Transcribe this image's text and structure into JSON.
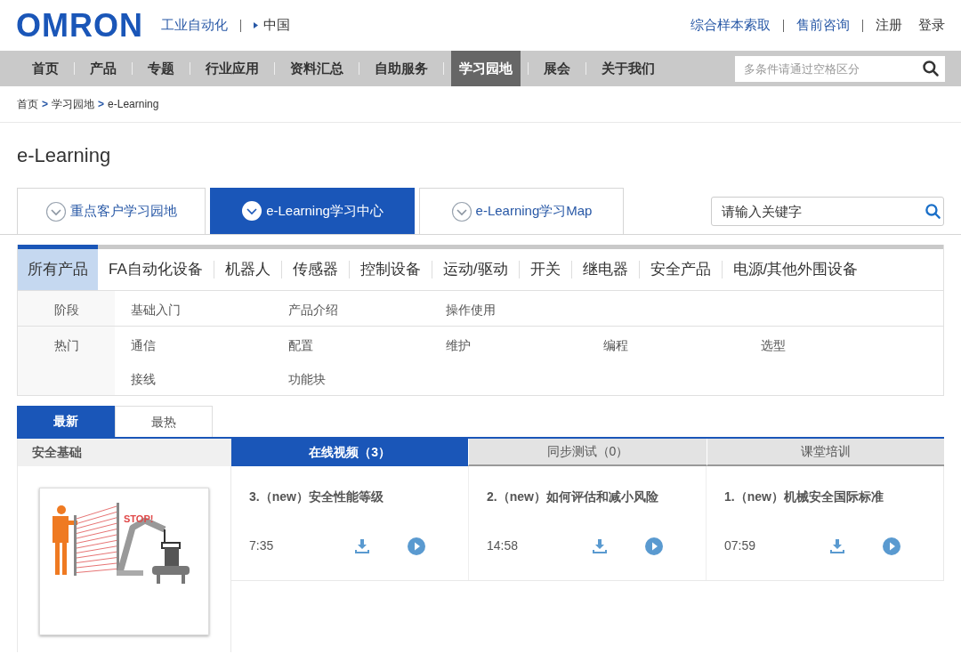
{
  "header": {
    "logo": "OMRON",
    "site": "工业自动化",
    "region": "中国",
    "links": [
      {
        "label": "综合样本索取",
        "kind": "accent"
      },
      {
        "label": "售前咨询",
        "kind": "accent"
      },
      {
        "label": "注册",
        "kind": "plain"
      },
      {
        "label": "登录",
        "kind": "plain"
      }
    ]
  },
  "nav": {
    "items": [
      {
        "label": "首页",
        "selected": false
      },
      {
        "label": "产品",
        "selected": false
      },
      {
        "label": "专题",
        "selected": false
      },
      {
        "label": "行业应用",
        "selected": false
      },
      {
        "label": "资料汇总",
        "selected": false
      },
      {
        "label": "自助服务",
        "selected": false
      },
      {
        "label": "学习园地",
        "selected": true
      },
      {
        "label": "展会",
        "selected": false
      },
      {
        "label": "关于我们",
        "selected": false
      }
    ],
    "search": {
      "placeholder": "多条件请通过空格区分"
    }
  },
  "breadcrumb": {
    "separator": ">",
    "items": [
      "首页",
      "学习园地",
      "e-Learning"
    ]
  },
  "page_title": "e-Learning",
  "section_tabs": [
    {
      "label": "重点客户学习园地",
      "selected": false
    },
    {
      "label": "e-Learning学习中心",
      "selected": true
    },
    {
      "label": "e-Learning学习Map",
      "selected": false
    }
  ],
  "keyword_search": {
    "placeholder": "请输入关键字"
  },
  "categories": [
    {
      "label": "所有产品",
      "selected": true
    },
    {
      "label": "FA自动化设备",
      "selected": false
    },
    {
      "label": "机器人",
      "selected": false
    },
    {
      "label": "传感器",
      "selected": false
    },
    {
      "label": "控制设备",
      "selected": false
    },
    {
      "label": "运动/驱动",
      "selected": false
    },
    {
      "label": "开关",
      "selected": false
    },
    {
      "label": "继电器",
      "selected": false
    },
    {
      "label": "安全产品",
      "selected": false
    },
    {
      "label": "电源/其他外围设备",
      "selected": false
    }
  ],
  "filters": [
    {
      "label": "阶段",
      "options": [
        "基础入门",
        "产品介绍",
        "操作使用"
      ]
    },
    {
      "label": "热门",
      "options": [
        "通信",
        "配置",
        "维护",
        "编程",
        "选型",
        "接线",
        "功能块"
      ]
    }
  ],
  "sort_tabs": [
    {
      "label": "最新",
      "selected": true
    },
    {
      "label": "最热",
      "selected": false
    }
  ],
  "topic": {
    "title": "安全基础",
    "illustration_text": "STOP!"
  },
  "content_tabs": [
    {
      "label": "在线视频（3）",
      "selected": true
    },
    {
      "label": "同步测试（0）",
      "selected": false
    },
    {
      "label": "课堂培训",
      "selected": false
    }
  ],
  "videos": [
    {
      "title": "3.（new）安全性能等级",
      "duration": "7:35"
    },
    {
      "title": "2.（new）如何评估和减小风险",
      "duration": "14:58"
    },
    {
      "title": "1.（new）机械安全国际标准",
      "duration": "07:59"
    }
  ]
}
